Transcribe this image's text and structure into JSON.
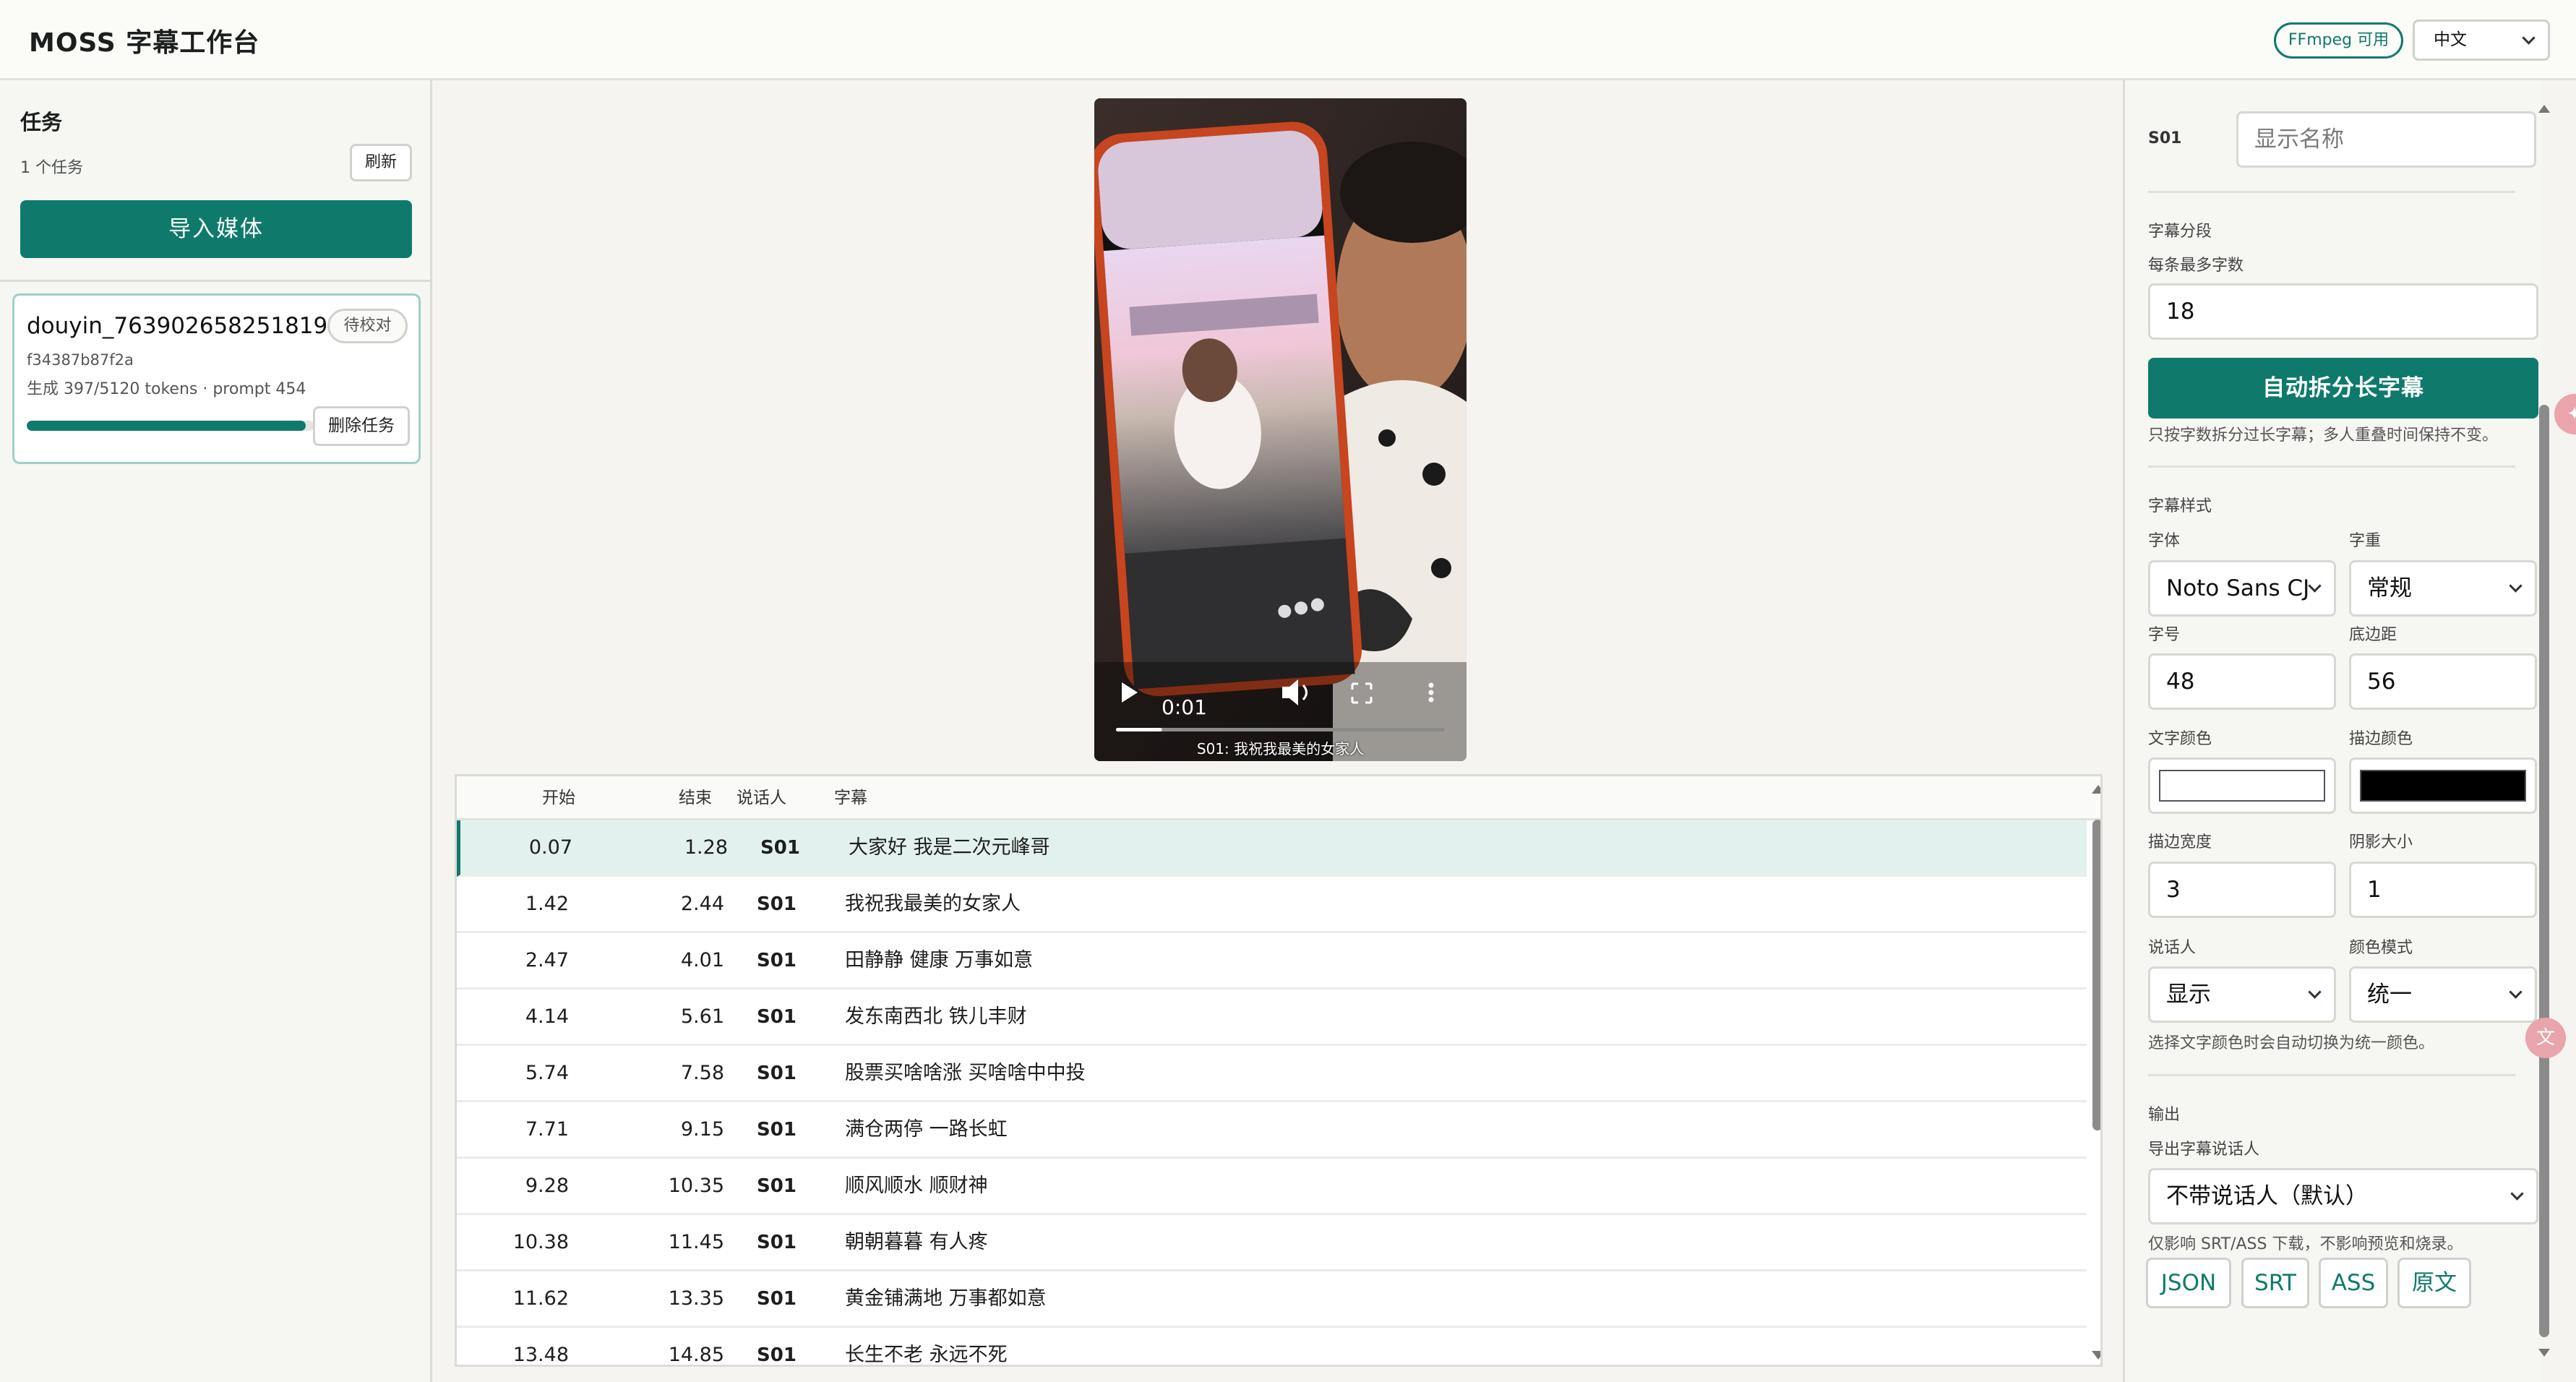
{
  "header": {
    "title": "MOSS 字幕工作台",
    "ffmpeg_badge": "FFmpeg 可用",
    "language": "中文"
  },
  "sidebar": {
    "title": "任务",
    "task_count": "1 个任务",
    "refresh_label": "刷新",
    "import_label": "导入媒体",
    "tasks": [
      {
        "name": "douyin_763902658251819...",
        "status": "待校对",
        "hash": "f34387b87f2a",
        "tokens": "生成 397/5120 tokens · prompt 454",
        "progress": 0.97,
        "delete_label": "删除任务"
      }
    ]
  },
  "video": {
    "time": "0:01",
    "caption": "S01: 我祝我最美的女家人",
    "progress": 0.14
  },
  "table": {
    "columns": {
      "start": "开始",
      "end": "结束",
      "speaker": "说话人",
      "text": "字幕"
    },
    "rows": [
      {
        "start": "0.07",
        "end": "1.28",
        "speaker": "S01",
        "text": "大家好 我是二次元峰哥"
      },
      {
        "start": "1.42",
        "end": "2.44",
        "speaker": "S01",
        "text": "我祝我最美的女家人"
      },
      {
        "start": "2.47",
        "end": "4.01",
        "speaker": "S01",
        "text": "田静静 健康 万事如意"
      },
      {
        "start": "4.14",
        "end": "5.61",
        "speaker": "S01",
        "text": "发东南西北 铁儿丰财"
      },
      {
        "start": "5.74",
        "end": "7.58",
        "speaker": "S01",
        "text": "股票买啥啥涨 买啥啥中中投"
      },
      {
        "start": "7.71",
        "end": "9.15",
        "speaker": "S01",
        "text": "满仓两停 一路长虹"
      },
      {
        "start": "9.28",
        "end": "10.35",
        "speaker": "S01",
        "text": "顺风顺水 顺财神"
      },
      {
        "start": "10.38",
        "end": "11.45",
        "speaker": "S01",
        "text": "朝朝暮暮 有人疼"
      },
      {
        "start": "11.62",
        "end": "13.35",
        "speaker": "S01",
        "text": "黄金铺满地 万事都如意"
      },
      {
        "start": "13.48",
        "end": "14.85",
        "speaker": "S01",
        "text": "长生不老 永远不死"
      }
    ]
  },
  "right": {
    "speaker_id": "S01",
    "display_name_placeholder": "显示名称",
    "segment": {
      "section_title": "字幕分段",
      "max_chars_label": "每条最多字数",
      "max_chars": "18",
      "split_button": "自动拆分长字幕",
      "hint": "只按字数拆分过长字幕；多人重叠时间保持不变。"
    },
    "style": {
      "section_title": "字幕样式",
      "font_label": "字体",
      "font": "Noto Sans CJ",
      "weight_label": "字重",
      "weight": "常规",
      "size_label": "字号",
      "size": "48",
      "margin_label": "底边距",
      "margin": "56",
      "text_color_label": "文字颜色",
      "text_color": "#ffffff",
      "outline_color_label": "描边颜色",
      "outline_color": "#000000",
      "outline_width_label": "描边宽度",
      "outline_width": "3",
      "shadow_label": "阴影大小",
      "shadow": "1",
      "speaker_label": "说话人",
      "speaker_mode": "显示",
      "color_mode_label": "颜色模式",
      "color_mode": "统一",
      "hint": "选择文字颜色时会自动切换为统一颜色。"
    },
    "output": {
      "section_title": "输出",
      "export_speaker_label": "导出字幕说话人",
      "export_speaker": "不带说话人（默认）",
      "hint": "仅影响 SRT/ASS 下载，不影响预览和烧录。",
      "buttons": [
        "JSON",
        "SRT",
        "ASS",
        "原文"
      ]
    }
  },
  "colors": {
    "accent": "#0f7a6c",
    "selected_row": "#e2f1ed",
    "background": "#f5f4f0"
  }
}
